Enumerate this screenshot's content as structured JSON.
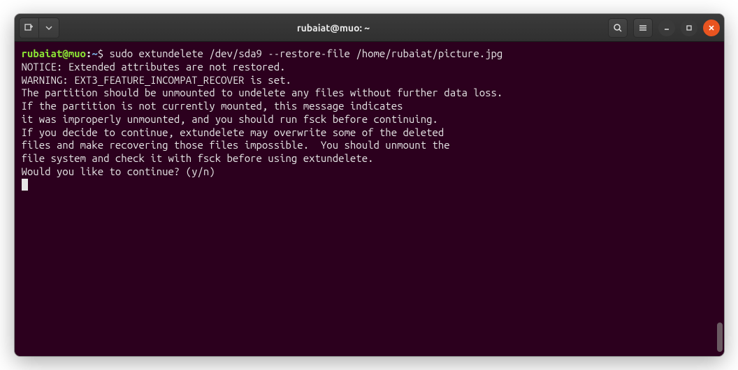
{
  "window": {
    "title": "rubaiat@muo: ~"
  },
  "prompt": {
    "user_host": "rubaiat@muo",
    "colon": ":",
    "path": "~",
    "dollar": "$ ",
    "command": "sudo extundelete /dev/sda9 --restore-file /home/rubaiat/picture.jpg"
  },
  "output": [
    "NOTICE: Extended attributes are not restored.",
    "WARNING: EXT3_FEATURE_INCOMPAT_RECOVER is set.",
    "The partition should be unmounted to undelete any files without further data loss.",
    "If the partition is not currently mounted, this message indicates",
    "it was improperly unmounted, and you should run fsck before continuing.",
    "If you decide to continue, extundelete may overwrite some of the deleted",
    "files and make recovering those files impossible.  You should unmount the",
    "file system and check it with fsck before using extundelete.",
    "Would you like to continue? (y/n)"
  ]
}
